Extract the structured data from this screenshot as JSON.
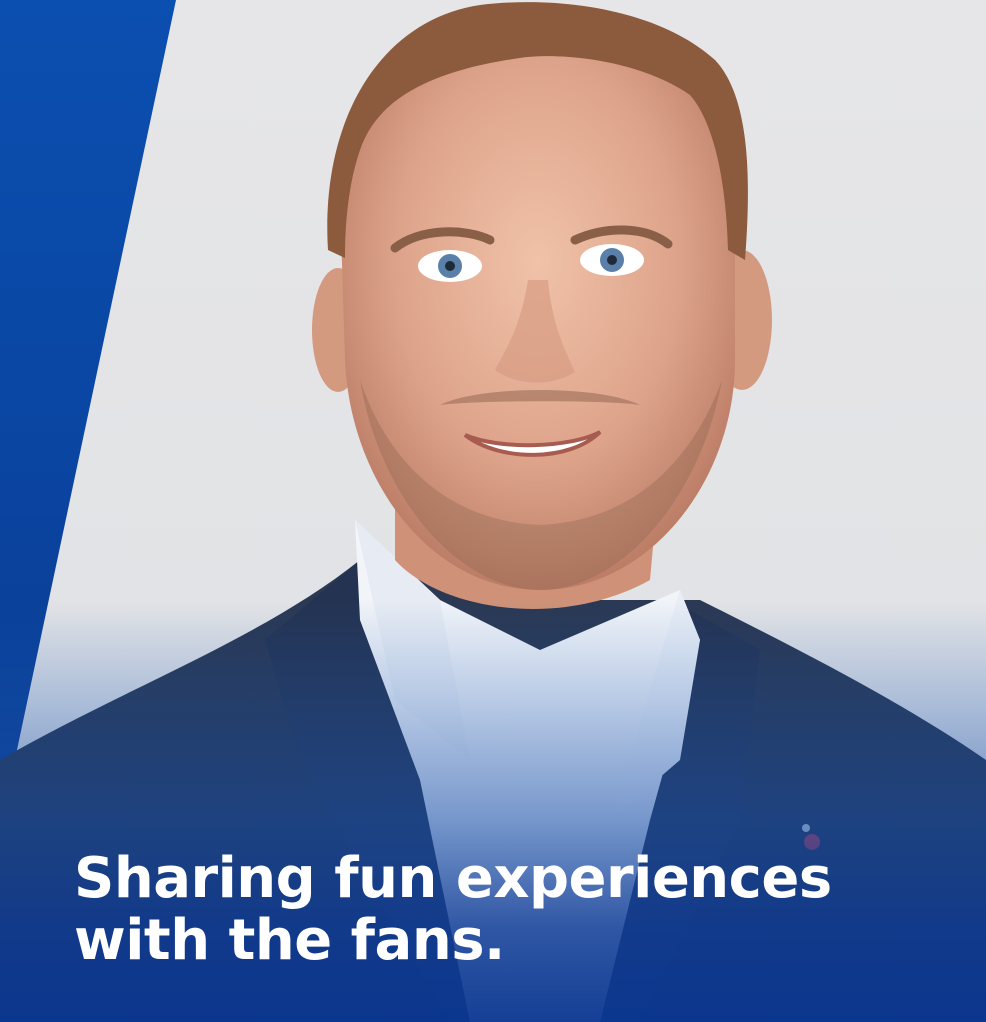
{
  "headline": {
    "line1": "Sharing fun experiences",
    "line2": "with the fans."
  },
  "colors": {
    "brand_blue": "#0a4aa8",
    "backdrop_grey": "#e4e4e6",
    "text": "#ffffff"
  }
}
